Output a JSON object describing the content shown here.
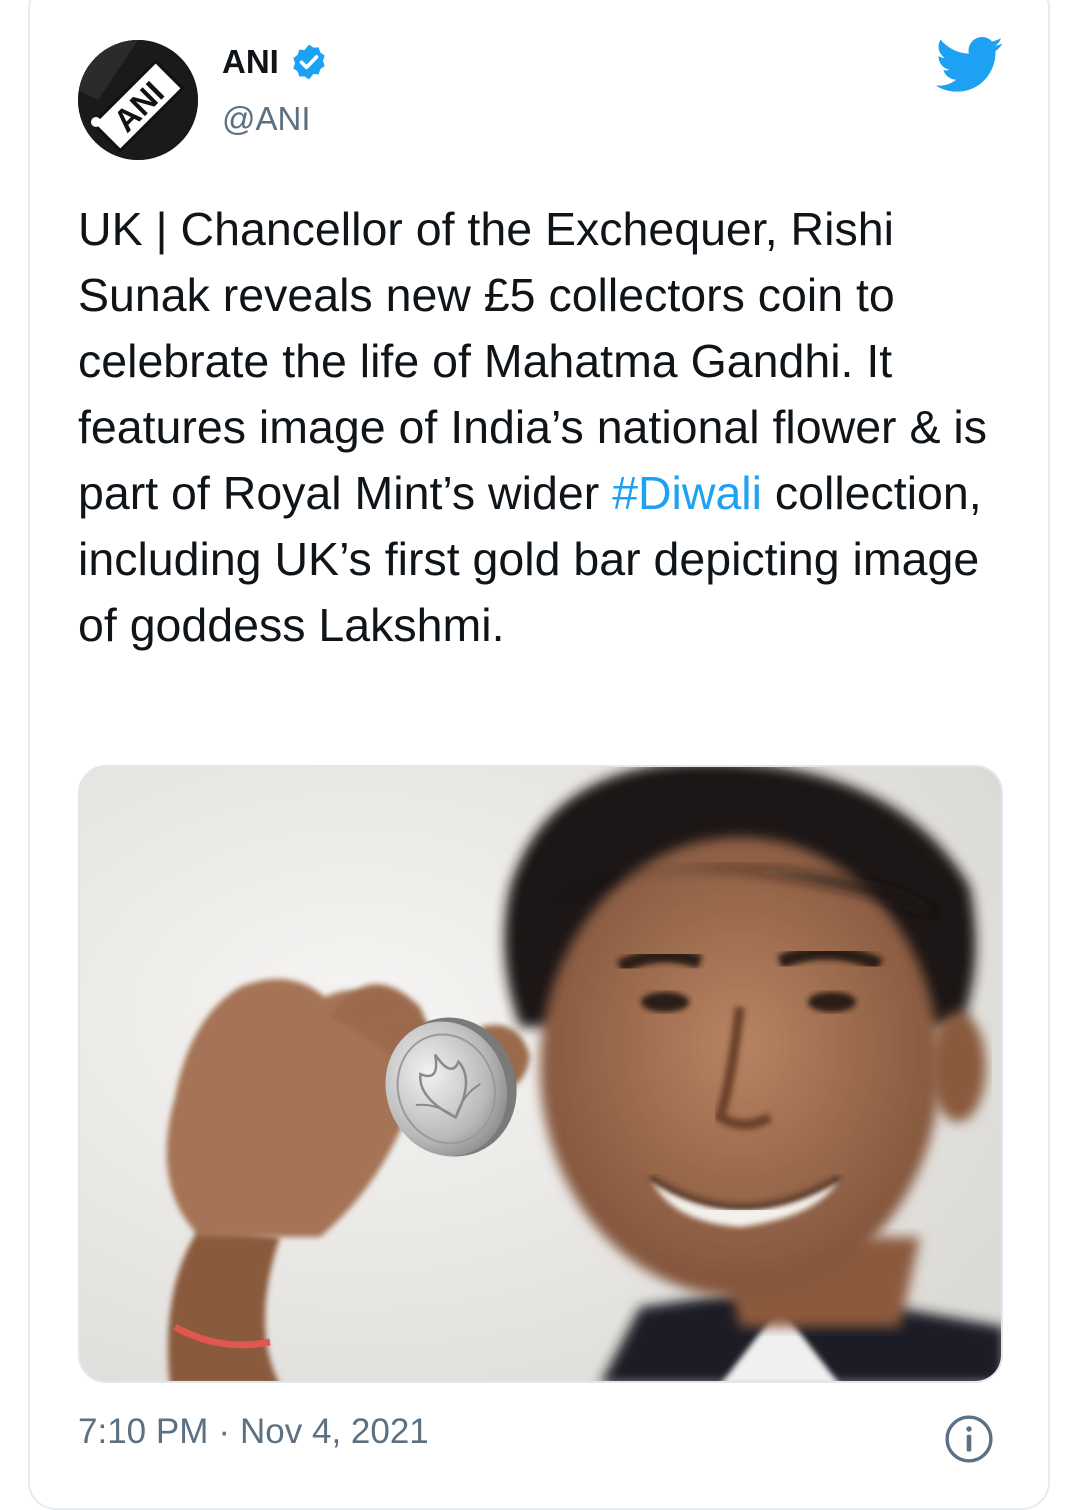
{
  "account": {
    "avatar_text": "ANI",
    "name": "ANI",
    "handle": "@ANI"
  },
  "tweet": {
    "text_before_hashtag": "UK | Chancellor of the Exchequer, Rishi Sunak reveals new £5 collectors coin to celebrate the life of Mahatma Gandhi. It features image of India’s national flower & is part of Royal Mint’s wider ",
    "hashtag": "#Diwali",
    "text_after_hashtag": " collection, including UK’s first gold bar depicting image of goddess Lakshmi."
  },
  "footer": {
    "time": "7:10 PM",
    "separator": "·",
    "date": "Nov 4, 2021"
  },
  "icons": {
    "verified": "verified-badge-icon",
    "twitter": "twitter-bird-icon",
    "info": "info-icon"
  },
  "colors": {
    "brand_blue": "#1da1f2",
    "text": "#0f1419",
    "secondary_text": "#5b7083",
    "border": "#e6ecf0"
  }
}
